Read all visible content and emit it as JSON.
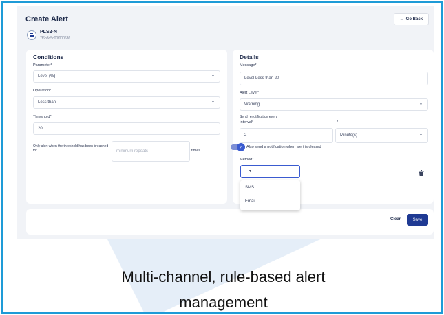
{
  "page": {
    "title": "Create Alert",
    "go_back_label": "Go Back",
    "device": {
      "name": "PLS2-N",
      "id": "7f6b3d5c00f000636"
    }
  },
  "conditions": {
    "heading": "Conditions",
    "parameter": {
      "label": "Parameter*",
      "value": "Level (%)"
    },
    "operation": {
      "label": "Operation*",
      "value": "Less than"
    },
    "threshold": {
      "label": "Threshold*",
      "value": "20"
    },
    "repeat": {
      "label": "Only alert when the threshold has been breached for",
      "placeholder": "minimum repeats",
      "suffix": "times"
    }
  },
  "details": {
    "heading": "Details",
    "message": {
      "label": "Message*",
      "value": "Level Less than 20"
    },
    "alert_level": {
      "label": "Alert Level*",
      "value": "Warning"
    },
    "send_every": "Send renotification every",
    "interval": {
      "label": "Interval*",
      "value": "2"
    },
    "unit": {
      "label": "*",
      "value": "Minute(s)"
    },
    "clear_toggle": {
      "label": "Also send a notification when alert is cleared",
      "on": true
    },
    "method": {
      "label": "Method*",
      "options": [
        "SMS",
        "Email"
      ]
    }
  },
  "actions": {
    "clear_label": "Clear",
    "save_label": "Save"
  },
  "caption": {
    "line1": "Multi-channel, rule-based alert",
    "line2": "management"
  },
  "colors": {
    "border": "#1e9bd7",
    "primary": "#1f3a93",
    "accent": "#3a5bd0"
  },
  "icons": {
    "back": "arrow-left-icon",
    "device": "device-icon",
    "delete": "trash-icon",
    "chevron": "chevron-down-icon",
    "check": "check-icon"
  }
}
